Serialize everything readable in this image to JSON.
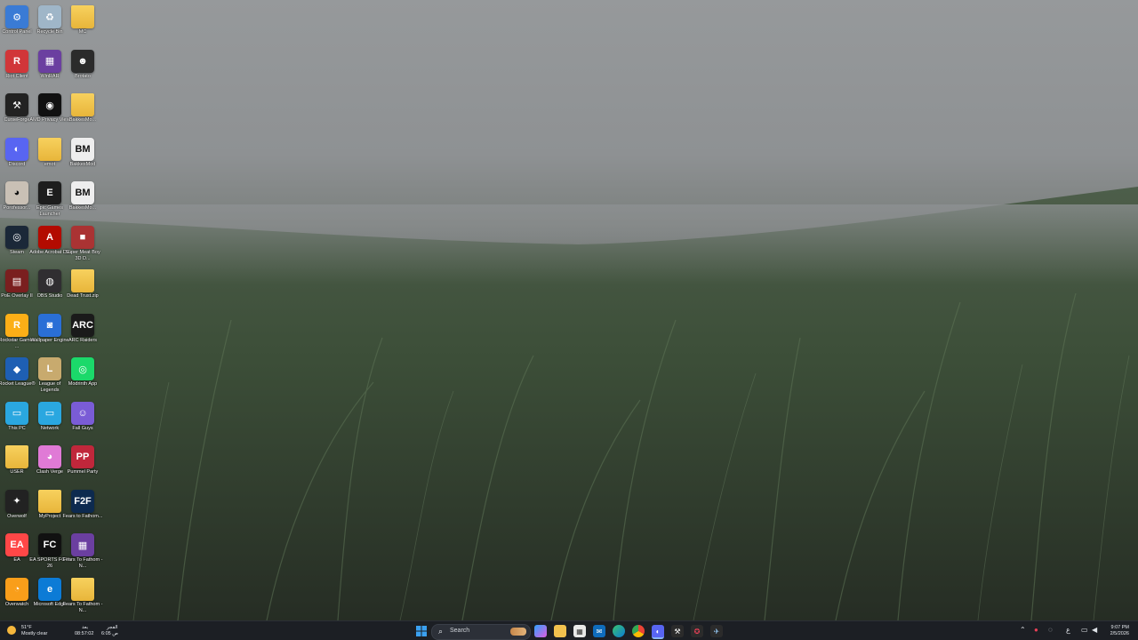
{
  "desktop": {
    "icons": [
      {
        "label": "Control Panel",
        "glyph": "⚙",
        "color": "#3a7bd5"
      },
      {
        "label": "Recycle Bin",
        "glyph": "♻",
        "color": "#9fb6c8"
      },
      {
        "label": "MC",
        "glyph": "",
        "color": "folder"
      },
      {
        "label": "Riot Client",
        "glyph": "R",
        "color": "#d13639"
      },
      {
        "label": "WinRAR",
        "glyph": "▦",
        "color": "#6b3fa0"
      },
      {
        "label": "Brotato",
        "glyph": "☻",
        "color": "#2b2b2b"
      },
      {
        "label": "CurseForge",
        "glyph": "⚒",
        "color": "#222"
      },
      {
        "label": "AMD Privacy View",
        "glyph": "◉",
        "color": "#111"
      },
      {
        "label": "BakkesMo...",
        "glyph": "",
        "color": "folder"
      },
      {
        "label": "Discord",
        "glyph": "◐",
        "color": "#5865f2"
      },
      {
        "label": "emot",
        "glyph": "",
        "color": "folder"
      },
      {
        "label": "BakkesMod",
        "glyph": "BM",
        "color": "#eee"
      },
      {
        "label": "Porofessor...",
        "glyph": "◕",
        "color": "#c9c0b5"
      },
      {
        "label": "Epic Games Launcher",
        "glyph": "E",
        "color": "#1d1d1d"
      },
      {
        "label": "BakkesMo...",
        "glyph": "BM",
        "color": "#eee"
      },
      {
        "label": "Steam",
        "glyph": "◎",
        "color": "#1b2838"
      },
      {
        "label": "Adobe Acrobat DC",
        "glyph": "A",
        "color": "#b30b00"
      },
      {
        "label": "Super Meat Boy 3D D...",
        "glyph": "■",
        "color": "#a33"
      },
      {
        "label": "PoE Overlay II",
        "glyph": "▤",
        "color": "#7a1f1f"
      },
      {
        "label": "OBS Studio",
        "glyph": "◍",
        "color": "#302e31"
      },
      {
        "label": "Dead Trust.zip",
        "glyph": "",
        "color": "folder"
      },
      {
        "label": "Rockstar Games ...",
        "glyph": "R",
        "color": "#fcaf17"
      },
      {
        "label": "Wallpaper Engine",
        "glyph": "◙",
        "color": "#2a6fd6"
      },
      {
        "label": "ARC Raiders",
        "glyph": "ARC",
        "color": "#1a1a1a"
      },
      {
        "label": "Rocket League®",
        "glyph": "◆",
        "color": "#1e5fb3"
      },
      {
        "label": "League of Legends",
        "glyph": "L",
        "color": "#c8aa6e"
      },
      {
        "label": "Modrinth App",
        "glyph": "◎",
        "color": "#1bd96a"
      },
      {
        "label": "This PC",
        "glyph": "▭",
        "color": "#2aa7e0"
      },
      {
        "label": "Network",
        "glyph": "▭",
        "color": "#2aa7e0"
      },
      {
        "label": "Fall Guys",
        "glyph": "☺",
        "color": "#7a5cd6"
      },
      {
        "label": "USER",
        "glyph": "",
        "color": "folder"
      },
      {
        "label": "Clash Verge",
        "glyph": "◕",
        "color": "#e07ad6"
      },
      {
        "label": "Pummel Party",
        "glyph": "PP",
        "color": "#c0273b"
      },
      {
        "label": "Overwolf",
        "glyph": "✦",
        "color": "#222"
      },
      {
        "label": "MyProject",
        "glyph": "",
        "color": "folder"
      },
      {
        "label": "Fears to Fathom...",
        "glyph": "F2F",
        "color": "#0d2a4f"
      },
      {
        "label": "EA",
        "glyph": "EA",
        "color": "#ff4747"
      },
      {
        "label": "EA SPORTS FC™ 26",
        "glyph": "FC",
        "color": "#111"
      },
      {
        "label": "Fears To Fathom - N...",
        "glyph": "▦",
        "color": "#6b3fa0"
      },
      {
        "label": "Overwatch",
        "glyph": "◔",
        "color": "#f99e1a"
      },
      {
        "label": "Microsoft Edge",
        "glyph": "e",
        "color": "#0c7bd6"
      },
      {
        "label": "Fears To Fathom - N...",
        "glyph": "",
        "color": "folder"
      }
    ]
  },
  "taskbar": {
    "weather": {
      "temp": "51°F",
      "condition": "Mostly clear"
    },
    "prayer": {
      "name": "الفجر",
      "label": "بعد",
      "time": "08:57:02",
      "clock": "6:05 ص"
    },
    "search_label": "Search",
    "clock": {
      "time": "9:07 PM",
      "date": "2/5/2026"
    },
    "lang": "ع"
  }
}
